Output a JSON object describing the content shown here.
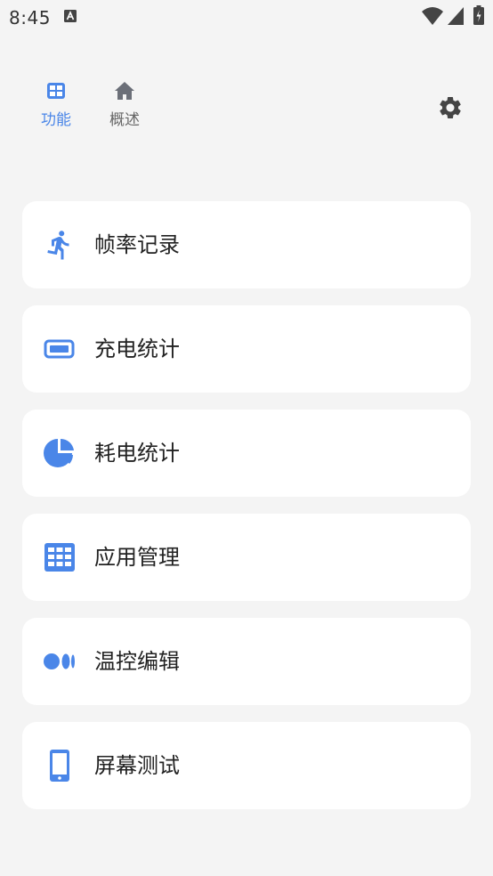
{
  "status_bar": {
    "time": "8:45"
  },
  "tabs": [
    {
      "label": "功能",
      "icon": "grid-icon",
      "active": true
    },
    {
      "label": "概述",
      "icon": "home-icon",
      "active": false
    }
  ],
  "header": {
    "settings_icon": "gear-icon"
  },
  "menu": [
    {
      "label": "帧率记录",
      "icon": "running-icon"
    },
    {
      "label": "充电统计",
      "icon": "battery-icon"
    },
    {
      "label": "耗电统计",
      "icon": "pie-chart-icon"
    },
    {
      "label": "应用管理",
      "icon": "apps-grid-icon"
    },
    {
      "label": "温控编辑",
      "icon": "dots-icon"
    },
    {
      "label": "屏幕测试",
      "icon": "phone-icon"
    }
  ],
  "colors": {
    "accent": "#4a86e8",
    "tab_inactive": "#666666",
    "card_bg": "#ffffff",
    "page_bg": "#f4f4f4"
  }
}
